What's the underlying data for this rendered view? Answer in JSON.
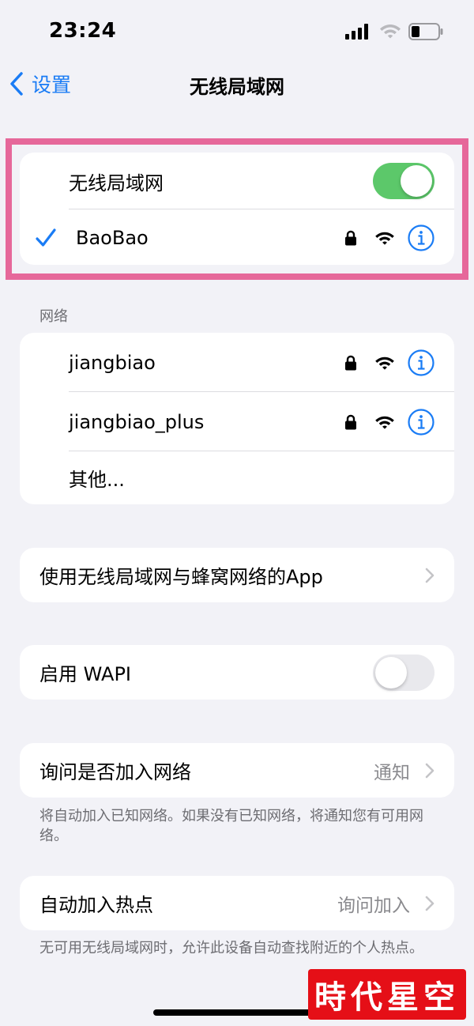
{
  "status_bar": {
    "time": "23:24"
  },
  "nav": {
    "back_label": "设置",
    "title": "无线局域网"
  },
  "wifi_card": {
    "toggle_label": "无线局域网",
    "toggle_on": true,
    "connected_network": "BaoBao"
  },
  "networks": {
    "header": "网络",
    "items": [
      {
        "name": "jiangbiao"
      },
      {
        "name": "jiangbiao_plus"
      }
    ],
    "other_label": "其他..."
  },
  "apps_row": {
    "label": "使用无线局域网与蜂窝网络的App"
  },
  "wapi_row": {
    "label": "启用 WAPI",
    "toggle_on": false
  },
  "ask_join": {
    "label": "询问是否加入网络",
    "value": "通知",
    "footnote": "将自动加入已知网络。如果没有已知网络，将通知您有可用网络。"
  },
  "hotspot": {
    "label": "自动加入热点",
    "value": "询问加入",
    "footnote": "无可用无线局域网时，允许此设备自动查找附近的个人热点。"
  },
  "watermark": "時代星空",
  "colors": {
    "accent": "#1a7cf5",
    "toggle_on": "#5cc86a",
    "highlight": "#e6689a",
    "background": "#f2f2f7",
    "watermark_bg": "#e50f17"
  }
}
